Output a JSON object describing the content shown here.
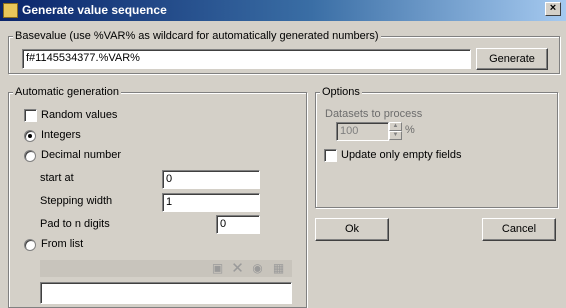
{
  "window": {
    "title": "Generate value sequence",
    "close_glyph": "×"
  },
  "basevalue": {
    "legend": "Basevalue (use %VAR% as wildcard for automatically generated numbers)",
    "input_value": "f#1145534377.%VAR%",
    "generate_label": "Generate"
  },
  "automatic": {
    "legend": "Automatic generation",
    "random_values_label": "Random values",
    "random_values_checked": false,
    "integers_label": "Integers",
    "integers_selected": true,
    "decimal_label": "Decimal number",
    "start_at_label": "start at",
    "start_at_value": "0",
    "stepping_label": "Stepping width",
    "stepping_value": "1",
    "pad_label": "Pad to n digits",
    "pad_value": "0",
    "from_list_label": "From list",
    "list_toolbar_icons": [
      "new-icon",
      "delete-icon",
      "settings-icon",
      "save-icon"
    ]
  },
  "options": {
    "legend": "Options",
    "datasets_label": "Datasets to process",
    "datasets_value": "100",
    "datasets_unit": "%",
    "update_empty_label": "Update only empty fields",
    "update_empty_checked": false
  },
  "buttons": {
    "ok_label": "Ok",
    "cancel_label": "Cancel"
  },
  "colors": {
    "titlebar_start": "#0a246a",
    "titlebar_end": "#a6caf0",
    "face": "#d4d0c8"
  }
}
